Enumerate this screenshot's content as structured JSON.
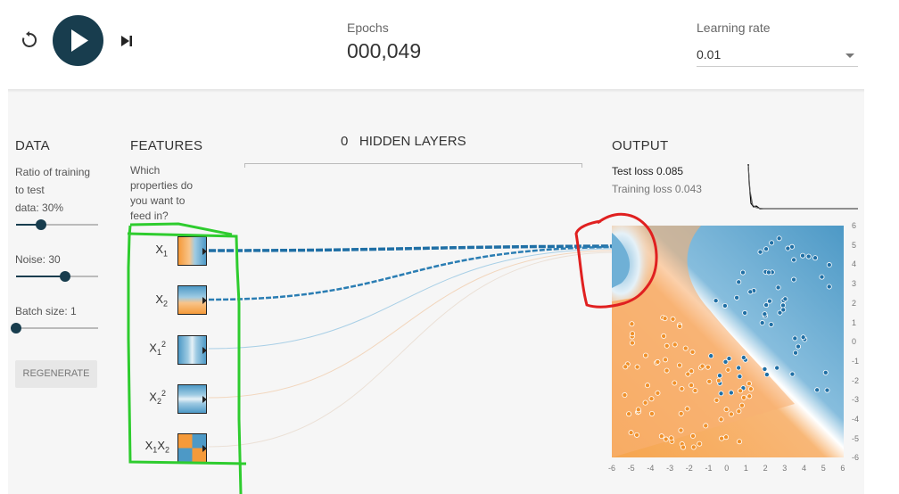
{
  "top": {
    "epoch_label": "Epochs",
    "epoch_value": "000,049",
    "lr_label": "Learning rate",
    "lr_value": "0.01"
  },
  "data_panel": {
    "title": "DATA",
    "ratio_label_1": "Ratio of training",
    "ratio_label_2": "to test",
    "ratio_label_3": "data:  30%",
    "ratio_value": 0.3,
    "noise_label": "Noise:  30",
    "noise_value": 0.6,
    "batch_label": "Batch size:  1",
    "batch_value": 0.0,
    "regen_label": "REGENERATE"
  },
  "features": {
    "title": "FEATURES",
    "desc_1": "Which",
    "desc_2": "properties do",
    "desc_3": "you want to",
    "desc_4": "feed in?",
    "items": [
      {
        "base": "X",
        "sub": "1",
        "sup": ""
      },
      {
        "base": "X",
        "sub": "2",
        "sup": ""
      },
      {
        "base": "X",
        "sub": "1",
        "sup": "2"
      },
      {
        "base": "X",
        "sub": "2",
        "sup": "2"
      },
      {
        "base": "X",
        "sub": "1",
        "mid": "X",
        "sub2": "2"
      }
    ]
  },
  "hidden": {
    "count": "0",
    "label": "HIDDEN LAYERS"
  },
  "output": {
    "title": "OUTPUT",
    "test_loss": "Test loss 0.085",
    "train_loss": "Training loss 0.043",
    "y_ticks": [
      "6",
      "5",
      "4",
      "3",
      "2",
      "1",
      "0",
      "-1",
      "-2",
      "-3",
      "-4",
      "-5",
      "-6"
    ],
    "x_ticks": [
      "-6",
      "-5",
      "-4",
      "-3",
      "-2",
      "-1",
      "0",
      "1",
      "2",
      "3",
      "4",
      "5",
      "6"
    ]
  },
  "colors": {
    "blue": "#4d99c6",
    "orange": "#f59a3a",
    "dark": "#183d4e",
    "annotation_green": "#2ecc2e",
    "annotation_red": "#e02020"
  },
  "icons": [
    "reset-icon",
    "play-icon",
    "step-icon",
    "dropdown-caret-icon"
  ]
}
